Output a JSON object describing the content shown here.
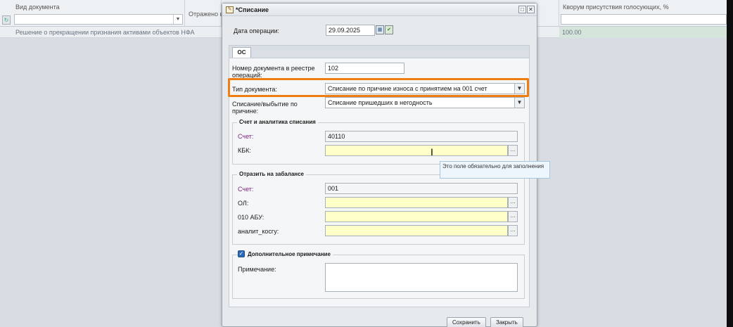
{
  "grid": {
    "columns": [
      {
        "label": "Вид документа"
      },
      {
        "label": "Отражено в"
      },
      {
        "label": "Кворум присутствия голосующих, %"
      }
    ],
    "row": {
      "document_type": "Решение о прекращении признания активами объектов НФА",
      "quorum": "100.00"
    }
  },
  "dialog": {
    "title": "*Списание",
    "operation_date": {
      "label": "Дата операции:",
      "value": "29.09.2025"
    },
    "tab_label": "ОС",
    "doc_number": {
      "label": "Номер документа в реестре операций:",
      "value": "102"
    },
    "doc_type": {
      "label": "Тип документа:",
      "value": "Списание по причине износа с принятием на 001 счет"
    },
    "writeoff_reason": {
      "label": "Списание/выбытие по причине:",
      "value": "Списание пришедших в негодность"
    },
    "account_section": {
      "legend": "Счет и аналитика списания",
      "account_label": "Счет:",
      "account_value": "40110",
      "kbk_label": "КБК:",
      "kbk_value": ""
    },
    "tooltip": "Это поле обязательно для заполнения",
    "offbalance_section": {
      "legend": "Отразить на забалансе",
      "account_label": "Счет:",
      "account_value": "001",
      "ol_label": "ОЛ:",
      "abu_label": "010 АБУ:",
      "kosgu_label": "аналит_косгу:"
    },
    "note_section": {
      "legend": "Дополнительное примечание",
      "checked": true,
      "note_label": "Примечание:",
      "note_value": ""
    },
    "save_label": "Сохранить",
    "close_label": "Закрыть"
  }
}
